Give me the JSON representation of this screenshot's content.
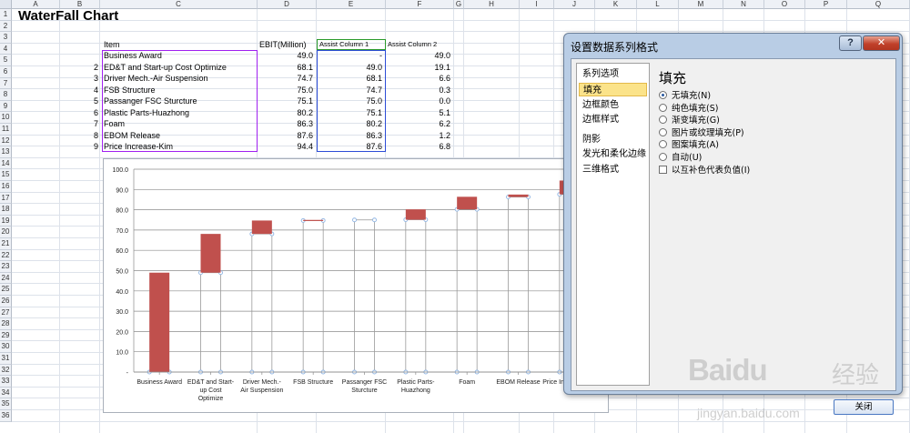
{
  "sheet": {
    "title": "WaterFall Chart",
    "columns": [
      "A",
      "B",
      "C",
      "D",
      "E",
      "F",
      "G",
      "H",
      "I",
      "J",
      "K",
      "L",
      "M",
      "N",
      "O",
      "P",
      "Q"
    ],
    "rows": [
      "1",
      "2",
      "3",
      "4",
      "5",
      "6",
      "7",
      "8",
      "9",
      "10",
      "11",
      "12",
      "13",
      "14",
      "15",
      "16",
      "17",
      "18",
      "19",
      "20",
      "21",
      "22",
      "23",
      "24",
      "25",
      "26",
      "27",
      "28",
      "29",
      "30",
      "31",
      "32",
      "33",
      "34",
      "35",
      "36"
    ],
    "headers": {
      "item": "Item",
      "ebit": "EBIT(Million)",
      "assist1": "Assist Column 1",
      "assist2": "Assist Column 2"
    },
    "data_rows": [
      {
        "idx": "",
        "item": "Business Award",
        "ebit": "49.0",
        "a1": "-",
        "a2": "49.0"
      },
      {
        "idx": "2",
        "item": "ED&T and Start-up Cost Optimize",
        "ebit": "68.1",
        "a1": "49.0",
        "a2": "19.1"
      },
      {
        "idx": "3",
        "item": "Driver Mech.-Air Suspension",
        "ebit": "74.7",
        "a1": "68.1",
        "a2": "6.6"
      },
      {
        "idx": "4",
        "item": "FSB Structure",
        "ebit": "75.0",
        "a1": "74.7",
        "a2": "0.3"
      },
      {
        "idx": "5",
        "item": "Passanger FSC Sturcture",
        "ebit": "75.1",
        "a1": "75.0",
        "a2": "0.0"
      },
      {
        "idx": "6",
        "item": "Plastic Parts-Huazhong",
        "ebit": "80.2",
        "a1": "75.1",
        "a2": "5.1"
      },
      {
        "idx": "7",
        "item": "Foam",
        "ebit": "86.3",
        "a1": "80.2",
        "a2": "6.2"
      },
      {
        "idx": "8",
        "item": "EBOM Release",
        "ebit": "87.6",
        "a1": "86.3",
        "a2": "1.2"
      },
      {
        "idx": "9",
        "item": "Price Increase-Kim",
        "ebit": "94.4",
        "a1": "87.6",
        "a2": "6.8"
      }
    ]
  },
  "chart_data": {
    "type": "bar",
    "stacked": true,
    "categories": [
      "Business Award",
      "ED&T and Start-up Cost Optimize",
      "Driver Mech.-Air Suspension",
      "FSB Structure",
      "Passanger FSC Sturcture",
      "Plastic Parts-Huazhong",
      "Foam",
      "EBOM Release",
      "Price Increase-Kim"
    ],
    "category_labels_visible": [
      [
        "Business Award"
      ],
      [
        "ED&T and Start-",
        "up Cost",
        "Optimize"
      ],
      [
        "Driver Mech.-",
        "Air Suspension"
      ],
      [
        "FSB Structure"
      ],
      [
        "Passanger FSC",
        "Sturcture"
      ],
      [
        "Plastic Parts-",
        "Huazhong"
      ],
      [
        "Foam"
      ],
      [
        "EBOM Release"
      ],
      [
        "Price Increase-Kim"
      ]
    ],
    "series": [
      {
        "name": "Assist Column 1",
        "values": [
          0,
          49.0,
          68.1,
          74.7,
          75.0,
          75.1,
          80.2,
          86.3,
          87.6
        ],
        "fill": "none",
        "border": "#8eb4e3"
      },
      {
        "name": "Assist Column 2",
        "values": [
          49.0,
          19.1,
          6.6,
          0.3,
          0.0,
          5.1,
          6.2,
          1.2,
          6.8
        ],
        "fill": "#c0504d"
      }
    ],
    "yticks": [
      "-",
      "10.0",
      "20.0",
      "30.0",
      "40.0",
      "50.0",
      "60.0",
      "70.0",
      "80.0",
      "90.0",
      "100.0"
    ],
    "ylim": [
      0,
      100
    ],
    "grid": true,
    "legend": "none"
  },
  "dialog": {
    "title": "设置数据系列格式",
    "help_label": "?",
    "close_label": "✕",
    "nav_items": [
      "系列选项",
      "填充",
      "边框颜色",
      "边框样式",
      "阴影",
      "发光和柔化边缘",
      "三维格式"
    ],
    "active_nav": 1,
    "heading": "填充",
    "fill_options": [
      "无填充(N)",
      "纯色填充(S)",
      "渐变填充(G)",
      "图片或纹理填充(P)",
      "图案填充(A)",
      "自动(U)"
    ],
    "selected_option": 0,
    "invert_checkbox": "以互补色代表负值(I)",
    "close_button": "关闭"
  },
  "watermark": {
    "brand": "Baidu",
    "cn": "经验",
    "url": "jingyan.baidu.com"
  },
  "colors": {
    "bar_red": "#c0504d",
    "assist_border": "#8eb4e3",
    "selection_purple": "#a020f0",
    "selection_green": "#2a9a2a",
    "selection_blue": "#2d4dd6"
  }
}
